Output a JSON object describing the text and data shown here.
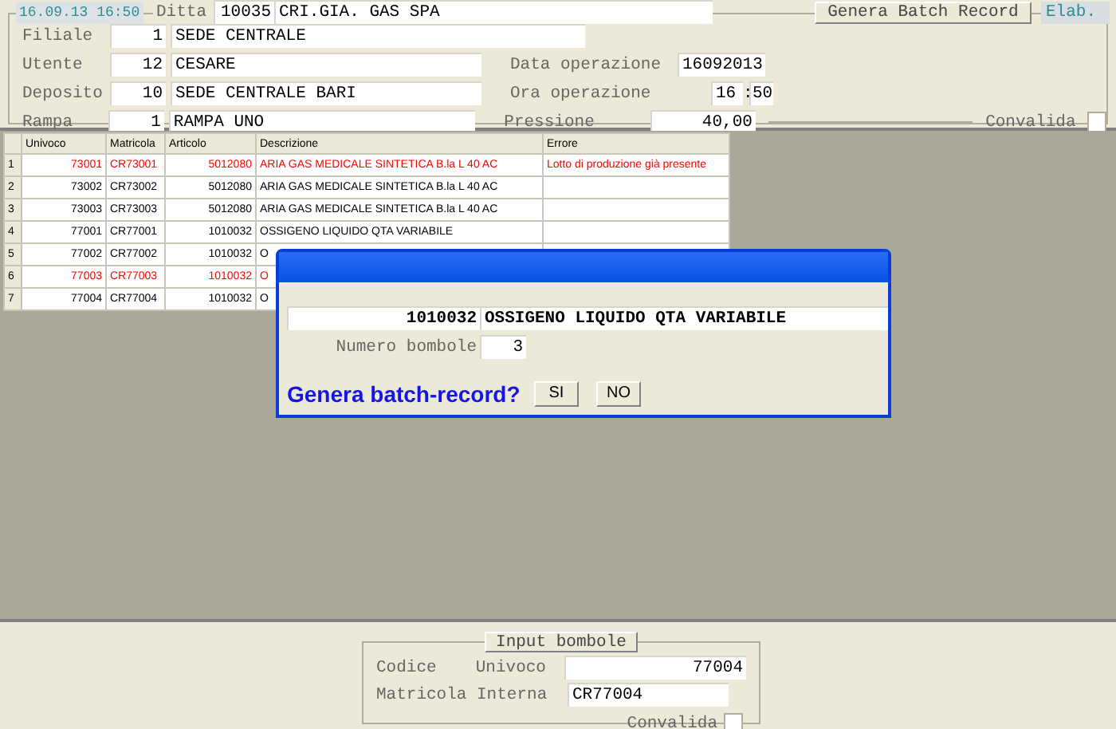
{
  "header": {
    "timestamp": "16.09.13 16:50",
    "ditta_label": "Ditta",
    "ditta_code": "10035",
    "ditta_name": "CRI.GIA. GAS SPA",
    "generate_button": "Genera Batch Record",
    "elab_label": "Elab."
  },
  "form": {
    "rows": [
      {
        "label": "Filiale",
        "code": "1",
        "name": "SEDE CENTRALE"
      },
      {
        "label": "Utente",
        "code": "12",
        "name": "CESARE",
        "side": {
          "kind": "date",
          "label": "Data operazione",
          "value": "16092013"
        }
      },
      {
        "label": "Deposito",
        "code": "10",
        "name": "SEDE CENTRALE BARI",
        "side": {
          "kind": "time",
          "label": "Ora operazione",
          "hours": "16",
          "separator": ":",
          "minutes": "50"
        }
      },
      {
        "label": "Rampa",
        "code": "1",
        "name": "RAMPA UNO",
        "side": {
          "kind": "pressure",
          "label": "Pressione",
          "value": "40,00",
          "check_label": "Convalida",
          "checked": false
        }
      }
    ]
  },
  "table": {
    "columns": [
      "Univoco",
      "Matricola",
      "Articolo",
      "Descrizione",
      "Errore"
    ],
    "rows": [
      {
        "number": "1",
        "univoco": "73001",
        "matricola": "CR73001",
        "articolo": "5012080",
        "descrizione": "ARIA GAS MEDICALE SINTETICA B.la L 40 AC",
        "errore": "Lotto di produzione già presente",
        "error": true
      },
      {
        "number": "2",
        "univoco": "73002",
        "matricola": "CR73002",
        "articolo": "5012080",
        "descrizione": "ARIA GAS MEDICALE SINTETICA B.la L 40 AC",
        "error": false
      },
      {
        "number": "3",
        "univoco": "73003",
        "matricola": "CR73003",
        "articolo": "5012080",
        "descrizione": "ARIA GAS MEDICALE SINTETICA B.la L 40 AC",
        "error": false
      },
      {
        "number": "4",
        "univoco": "77001",
        "matricola": "CR77001",
        "articolo": "1010032",
        "descrizione": "OSSIGENO LIQUIDO QTA VARIABILE",
        "error": false
      },
      {
        "number": "5",
        "univoco": "77002",
        "matricola": "CR77002",
        "articolo": "1010032",
        "descrizione": "O",
        "error": false
      },
      {
        "number": "6",
        "univoco": "77003",
        "matricola": "CR77003",
        "articolo": "1010032",
        "descrizione": "O",
        "error": true
      },
      {
        "number": "7",
        "univoco": "77004",
        "matricola": "CR77004",
        "articolo": "1010032",
        "descrizione": "O",
        "error": false
      }
    ]
  },
  "dialog": {
    "code": "1010032",
    "description": "OSSIGENO LIQUIDO QTA VARIABILE",
    "count_label": "Numero bombole",
    "count": "3",
    "question": "Genera batch-record?",
    "buttons": [
      "SI",
      "NO"
    ]
  },
  "input_panel": {
    "title": "Input bombole",
    "codice_label": "Codice",
    "univoco_label": "Univoco",
    "univoco": "77004",
    "matricola_label": "Matricola Interna",
    "matricola": "CR77004",
    "check_label": "Convalida",
    "checked": false
  }
}
